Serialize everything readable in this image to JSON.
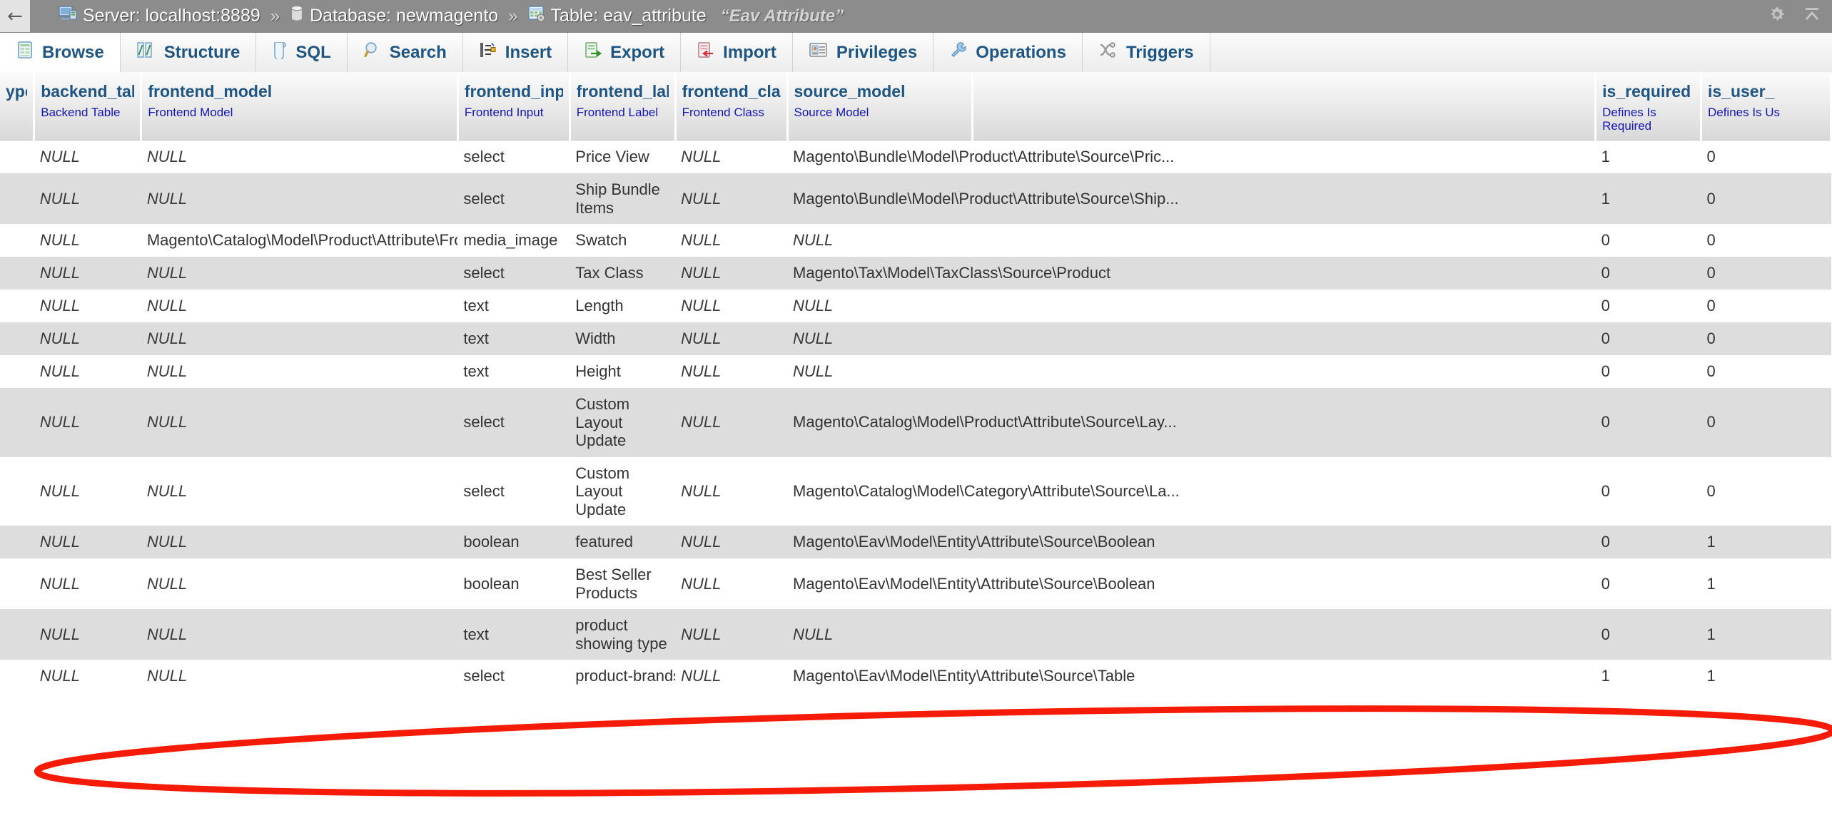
{
  "window": {
    "back_label": "←",
    "sysicons": [
      "gear-icon",
      "collapse-icon"
    ]
  },
  "breadcrumb": {
    "separator": "»",
    "items": [
      {
        "icon": "server-icon",
        "label": "Server: localhost:8889"
      },
      {
        "icon": "database-icon",
        "label": "Database: newmagento"
      },
      {
        "icon": "table-icon",
        "label": "Table: eav_attribute"
      }
    ],
    "table_alias": "“Eav Attribute”"
  },
  "tabs": [
    {
      "label": "Browse",
      "icon": "browse-icon",
      "active": true
    },
    {
      "label": "Structure",
      "icon": "structure-icon",
      "active": false
    },
    {
      "label": "SQL",
      "icon": "sql-icon",
      "active": false
    },
    {
      "label": "Search",
      "icon": "search-icon",
      "active": false
    },
    {
      "label": "Insert",
      "icon": "insert-icon",
      "active": false
    },
    {
      "label": "Export",
      "icon": "export-icon",
      "active": false
    },
    {
      "label": "Import",
      "icon": "import-icon",
      "active": false
    },
    {
      "label": "Privileges",
      "icon": "privileges-icon",
      "active": false
    },
    {
      "label": "Operations",
      "icon": "operations-icon",
      "active": false
    },
    {
      "label": "Triggers",
      "icon": "triggers-icon",
      "active": false
    }
  ],
  "grid": {
    "columns": [
      {
        "name": "ype",
        "comment": "",
        "clipped": true
      },
      {
        "name": "backend_table",
        "comment": "Backend Table"
      },
      {
        "name": "frontend_model",
        "comment": "Frontend Model"
      },
      {
        "name": "frontend_input",
        "comment": "Frontend Input"
      },
      {
        "name": "frontend_label",
        "comment": "Frontend Label"
      },
      {
        "name": "frontend_class",
        "comment": "Frontend Class"
      },
      {
        "name": "source_model",
        "comment": "Source Model"
      },
      {
        "name": "",
        "comment": ""
      },
      {
        "name": "is_required",
        "comment": "Defines Is Required"
      },
      {
        "name": "is_user_",
        "comment": "Defines Is Us",
        "clipped": true
      }
    ],
    "rows": [
      {
        "backend_table": "NULL",
        "frontend_model": "NULL",
        "frontend_input": "select",
        "frontend_label": "Price View",
        "frontend_class": "NULL",
        "source_model": "Magento\\Bundle\\Model\\Product\\Attribute\\Source\\Pric...",
        "is_required": "1",
        "is_user_defined": "0"
      },
      {
        "backend_table": "NULL",
        "frontend_model": "NULL",
        "frontend_input": "select",
        "frontend_label": "Ship Bundle Items",
        "frontend_class": "NULL",
        "source_model": "Magento\\Bundle\\Model\\Product\\Attribute\\Source\\Ship...",
        "is_required": "1",
        "is_user_defined": "0"
      },
      {
        "backend_table": "NULL",
        "frontend_model": "Magento\\Catalog\\Model\\Product\\Attribute\\Frontend\\I...",
        "frontend_input": "media_image",
        "frontend_label": "Swatch",
        "frontend_class": "NULL",
        "source_model": "NULL",
        "is_required": "0",
        "is_user_defined": "0"
      },
      {
        "backend_table": "NULL",
        "frontend_model": "NULL",
        "frontend_input": "select",
        "frontend_label": "Tax Class",
        "frontend_class": "NULL",
        "source_model": "Magento\\Tax\\Model\\TaxClass\\Source\\Product",
        "is_required": "0",
        "is_user_defined": "0"
      },
      {
        "backend_table": "NULL",
        "frontend_model": "NULL",
        "frontend_input": "text",
        "frontend_label": "Length",
        "frontend_class": "NULL",
        "source_model": "NULL",
        "is_required": "0",
        "is_user_defined": "0"
      },
      {
        "backend_table": "NULL",
        "frontend_model": "NULL",
        "frontend_input": "text",
        "frontend_label": "Width",
        "frontend_class": "NULL",
        "source_model": "NULL",
        "is_required": "0",
        "is_user_defined": "0"
      },
      {
        "backend_table": "NULL",
        "frontend_model": "NULL",
        "frontend_input": "text",
        "frontend_label": "Height",
        "frontend_class": "NULL",
        "source_model": "NULL",
        "is_required": "0",
        "is_user_defined": "0"
      },
      {
        "backend_table": "NULL",
        "frontend_model": "NULL",
        "frontend_input": "select",
        "frontend_label": "Custom Layout Update",
        "frontend_class": "NULL",
        "source_model": "Magento\\Catalog\\Model\\Product\\Attribute\\Source\\Lay...",
        "is_required": "0",
        "is_user_defined": "0"
      },
      {
        "backend_table": "NULL",
        "frontend_model": "NULL",
        "frontend_input": "select",
        "frontend_label": "Custom Layout Update",
        "frontend_class": "NULL",
        "source_model": "Magento\\Catalog\\Model\\Category\\Attribute\\Source\\La...",
        "is_required": "0",
        "is_user_defined": "0"
      },
      {
        "backend_table": "NULL",
        "frontend_model": "NULL",
        "frontend_input": "boolean",
        "frontend_label": "featured",
        "frontend_class": "NULL",
        "source_model": "Magento\\Eav\\Model\\Entity\\Attribute\\Source\\Boolean",
        "is_required": "0",
        "is_user_defined": "1"
      },
      {
        "backend_table": "NULL",
        "frontend_model": "NULL",
        "frontend_input": "boolean",
        "frontend_label": "Best Seller Products",
        "frontend_class": "NULL",
        "source_model": "Magento\\Eav\\Model\\Entity\\Attribute\\Source\\Boolean",
        "is_required": "0",
        "is_user_defined": "1"
      },
      {
        "backend_table": "NULL",
        "frontend_model": "NULL",
        "frontend_input": "text",
        "frontend_label": "product showing type",
        "frontend_class": "NULL",
        "source_model": "NULL",
        "is_required": "0",
        "is_user_defined": "1"
      },
      {
        "backend_table": "NULL",
        "frontend_model": "NULL",
        "frontend_input": "select",
        "frontend_label": "product-brands",
        "frontend_class": "NULL",
        "source_model": "Magento\\Eav\\Model\\Entity\\Attribute\\Source\\Table",
        "is_required": "1",
        "is_user_defined": "1"
      }
    ]
  },
  "annotation": {
    "shape": "ellipse",
    "color": "#f61b06",
    "target_row_label": "product-brands"
  },
  "colors": {
    "bar_background": "#8c8c8c",
    "tab_text": "#1f5582",
    "column_header_name": "#1f5582",
    "column_comment": "#1414b8",
    "row_even": "#dddddd",
    "row_odd": "#ffffff",
    "annotation": "#f61b06"
  }
}
